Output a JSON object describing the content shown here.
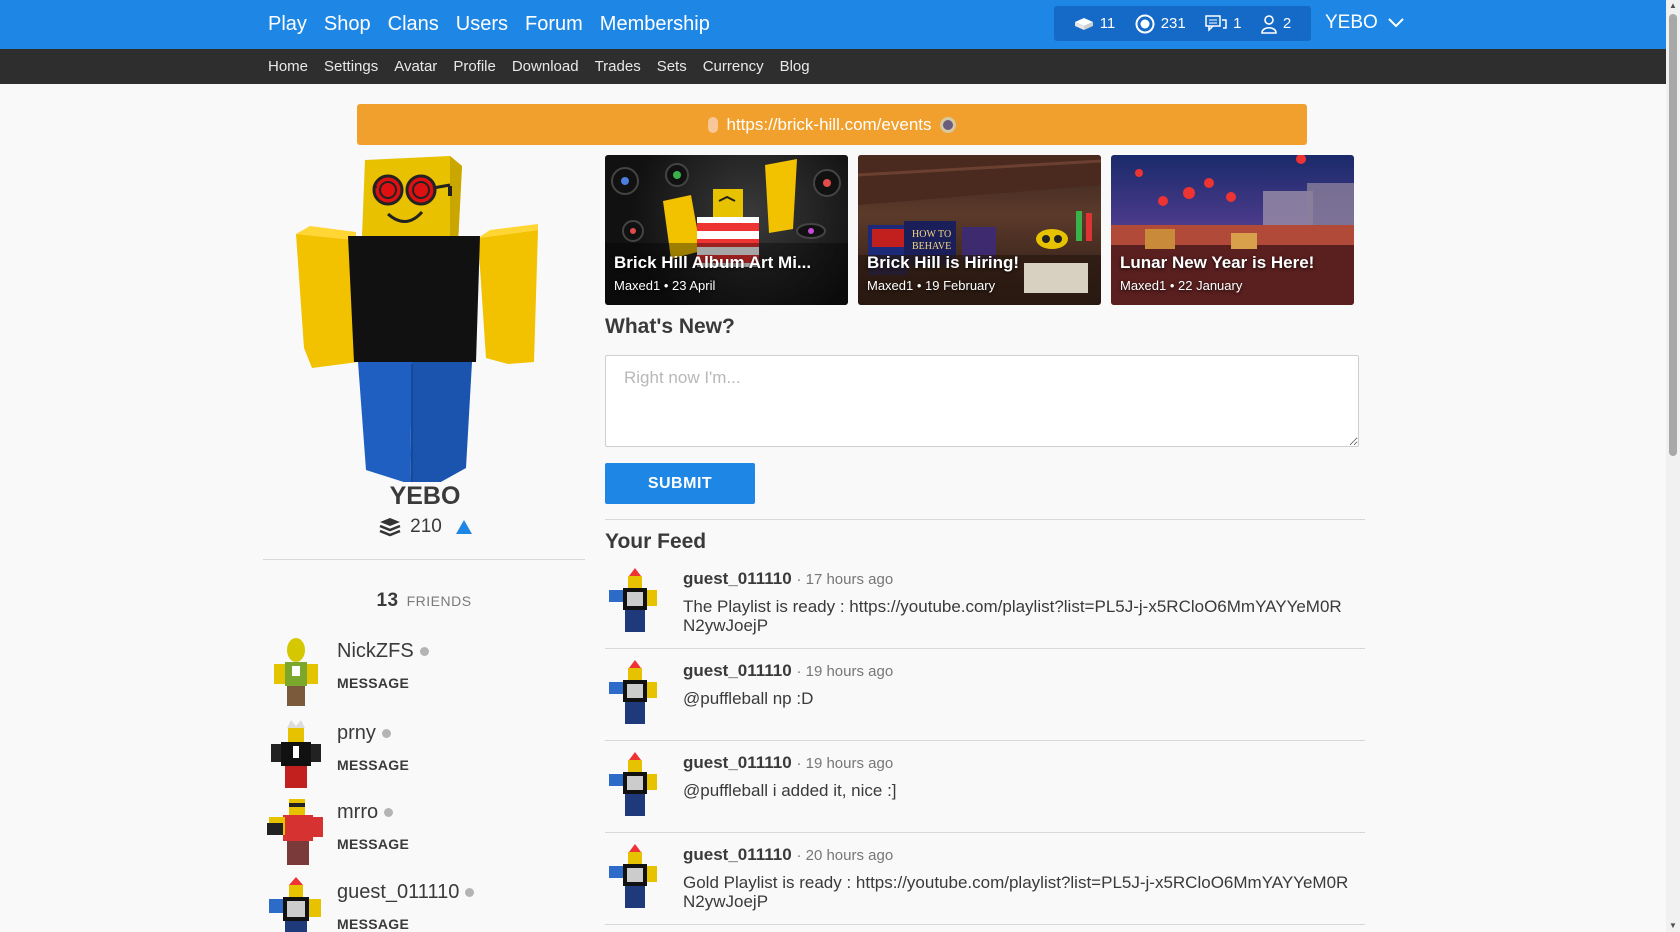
{
  "topnav": {
    "items": [
      "Play",
      "Shop",
      "Clans",
      "Users",
      "Forum",
      "Membership"
    ]
  },
  "stats": {
    "bricks": "11",
    "bucks": "231",
    "messages": "1",
    "friend_requests": "2"
  },
  "user_menu": {
    "name": "YEBO"
  },
  "subnav": {
    "items": [
      "Home",
      "Settings",
      "Avatar",
      "Profile",
      "Download",
      "Trades",
      "Sets",
      "Currency",
      "Blog"
    ]
  },
  "banner": {
    "link": "https://brick-hill.com/events"
  },
  "profile": {
    "name": "YEBO",
    "rank_value": "210"
  },
  "friends": {
    "count": "13",
    "label": "FRIENDS",
    "list": [
      {
        "name": "NickZFS",
        "action": "MESSAGE"
      },
      {
        "name": "prny",
        "action": "MESSAGE"
      },
      {
        "name": "mrro",
        "action": "MESSAGE"
      },
      {
        "name": "guest_011110",
        "action": "MESSAGE"
      }
    ]
  },
  "news": [
    {
      "title": "Brick Hill Album Art Mi...",
      "meta": "Maxed1 • 23 April"
    },
    {
      "title": "Brick Hill is Hiring!",
      "meta": "Maxed1 • 19 February"
    },
    {
      "title": "Lunar New Year is Here!",
      "meta": "Maxed1 • 22 January"
    }
  ],
  "whats_new": {
    "title": "What's New?",
    "placeholder": "Right now I'm...",
    "submit": "SUBMIT"
  },
  "feed": {
    "title": "Your Feed",
    "posts": [
      {
        "user": "guest_011110",
        "time": "· 17 hours ago",
        "text": "The Playlist is ready : https://youtube.com/playlist?list=PL5J-j-x5RCloO6MmYAYYeM0RN2ywJoejP"
      },
      {
        "user": "guest_011110",
        "time": "· 19 hours ago",
        "text": "@puffleball np :D"
      },
      {
        "user": "guest_011110",
        "time": "· 19 hours ago",
        "text": "@puffleball i added it, nice :]"
      },
      {
        "user": "guest_011110",
        "time": "· 20 hours ago",
        "text": "Gold Playlist is ready : https://youtube.com/playlist?list=PL5J-j-x5RCloO6MmYAYYeM0RN2ywJoejP"
      }
    ]
  },
  "colors": {
    "primary": "#1e87e6",
    "subnav_bg": "#2e2e2e",
    "banner": "#f2a02d"
  }
}
